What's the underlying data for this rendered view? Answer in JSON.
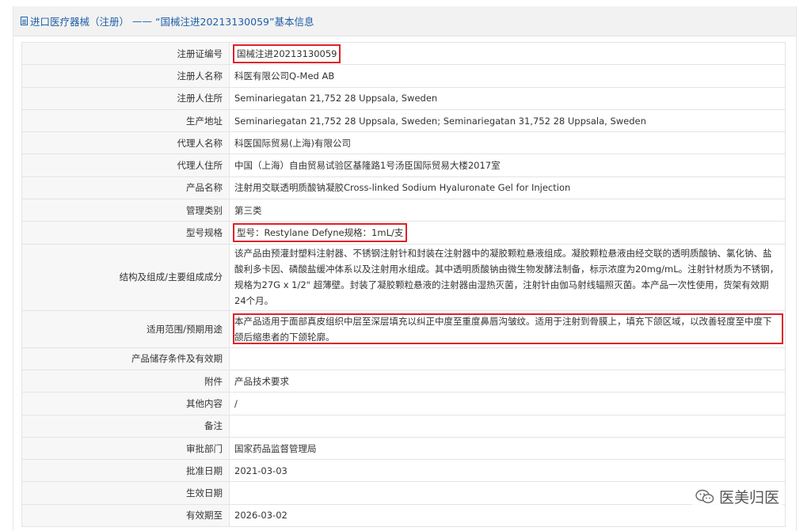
{
  "header": {
    "breadcrumb": "进口医疗器械（注册）",
    "separator": "——",
    "title": "“国械注进20213130059”基本信息"
  },
  "rows": [
    {
      "label": "注册证编号",
      "value": "国械注进20213130059"
    },
    {
      "label": "注册人名称",
      "value": "科医有限公司Q-Med AB"
    },
    {
      "label": "注册人住所",
      "value": "Seminariegatan 21,752 28 Uppsala, Sweden"
    },
    {
      "label": "生产地址",
      "value": "Seminariegatan 21,752 28 Uppsala, Sweden; Seminariegatan 31,752 28 Uppsala, Sweden"
    },
    {
      "label": "代理人名称",
      "value": "科医国际贸易(上海)有限公司"
    },
    {
      "label": "代理人住所",
      "value": "中国（上海）自由贸易试验区基隆路1号汤臣国际贸易大楼2017室"
    },
    {
      "label": "产品名称",
      "value": "注射用交联透明质酸钠凝胶Cross-linked Sodium Hyaluronate Gel for Injection"
    },
    {
      "label": "管理类别",
      "value": "第三类"
    },
    {
      "label": "型号规格",
      "value": "型号：Restylane Defyne规格：1mL/支"
    },
    {
      "label": "结构及组成/主要组成成分",
      "value": "该产品由预灌封塑料注射器、不锈钢注射针和封装在注射器中的凝胶颗粒悬液组成。凝胶颗粒悬液由经交联的透明质酸钠、氯化钠、盐酸利多卡因、磷酸盐缓冲体系以及注射用水组成。其中透明质酸钠由微生物发酵法制备，标示浓度为20mg/mL。注射针材质为不锈钢，规格为27G x 1/2\" 超薄壁。封装了凝胶颗粒悬液的注射器由湿热灭菌，注射针由伽马射线辐照灭菌。本产品一次性使用，货架有效期24个月。"
    },
    {
      "label": "适用范围/预期用途",
      "value": "本产品适用于面部真皮组织中层至深层填充以纠正中度至重度鼻唇沟皱纹。适用于注射到骨膜上，填充下颌区域，以改善轻度至中度下颌后缩患者的下颌轮廓。"
    },
    {
      "label": "产品储存条件及有效期",
      "value": ""
    },
    {
      "label": "附件",
      "value": "产品技术要求"
    },
    {
      "label": "其他内容",
      "value": "/"
    },
    {
      "label": "备注",
      "value": ""
    },
    {
      "label": "审批部门",
      "value": "国家药品监督管理局"
    },
    {
      "label": "批准日期",
      "value": "2021-03-03"
    },
    {
      "label": "生效日期",
      "value": ""
    },
    {
      "label": "有效期至",
      "value": "2026-03-02"
    }
  ],
  "watermark": {
    "text": "医美归医",
    "icon": "wechat-icon"
  },
  "colors": {
    "link": "#1f5fa8",
    "highlight": "#e0202a",
    "label_bg": "#f7f7f7"
  }
}
